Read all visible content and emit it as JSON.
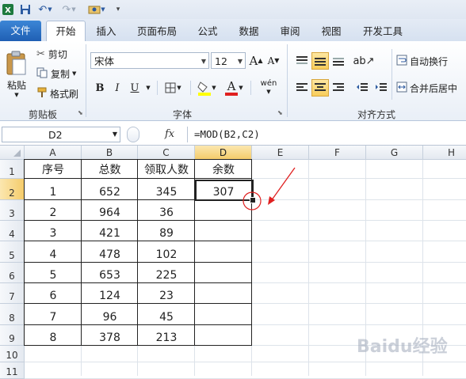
{
  "qat": {
    "icons": [
      "excel-logo-icon",
      "save-icon",
      "undo-icon",
      "redo-icon",
      "customize-icon"
    ]
  },
  "tabs": [
    {
      "label": "文件"
    },
    {
      "label": "开始"
    },
    {
      "label": "插入"
    },
    {
      "label": "页面布局"
    },
    {
      "label": "公式"
    },
    {
      "label": "数据"
    },
    {
      "label": "审阅"
    },
    {
      "label": "视图"
    },
    {
      "label": "开发工具"
    }
  ],
  "ribbon": {
    "clipboard": {
      "paste": "粘贴",
      "cut": "剪切",
      "copy": "复制",
      "format_painter": "格式刷",
      "group_label": "剪贴板"
    },
    "font": {
      "font_name": "宋体",
      "font_size": "12",
      "bold": "B",
      "italic": "I",
      "underline": "U",
      "group_label": "字体"
    },
    "alignment": {
      "wrap_text": "自动换行",
      "merge_center": "合并后居中",
      "group_label": "对齐方式"
    }
  },
  "formula_bar": {
    "name_box": "D2",
    "fx": "fx",
    "formula": "=MOD(B2,C2)"
  },
  "grid": {
    "columns": [
      "A",
      "B",
      "C",
      "D",
      "E",
      "F",
      "G",
      "H"
    ],
    "rows": [
      "1",
      "2",
      "3",
      "4",
      "5",
      "6",
      "7",
      "8",
      "9",
      "10",
      "11"
    ],
    "selected_col": "D",
    "selected_row": "2",
    "headers": [
      "序号",
      "总数",
      "领取人数",
      "余数"
    ],
    "data": [
      [
        "1",
        "652",
        "345",
        "307"
      ],
      [
        "2",
        "964",
        "36",
        ""
      ],
      [
        "3",
        "421",
        "89",
        ""
      ],
      [
        "4",
        "478",
        "102",
        ""
      ],
      [
        "5",
        "653",
        "225",
        ""
      ],
      [
        "6",
        "124",
        "23",
        ""
      ],
      [
        "7",
        "96",
        "45",
        ""
      ],
      [
        "8",
        "378",
        "213",
        ""
      ]
    ]
  },
  "watermark": "Baidu经验",
  "colors": {
    "file_tab": "#1f5fb4",
    "selection": "#f5cc6b",
    "annotation": "#e02020"
  }
}
